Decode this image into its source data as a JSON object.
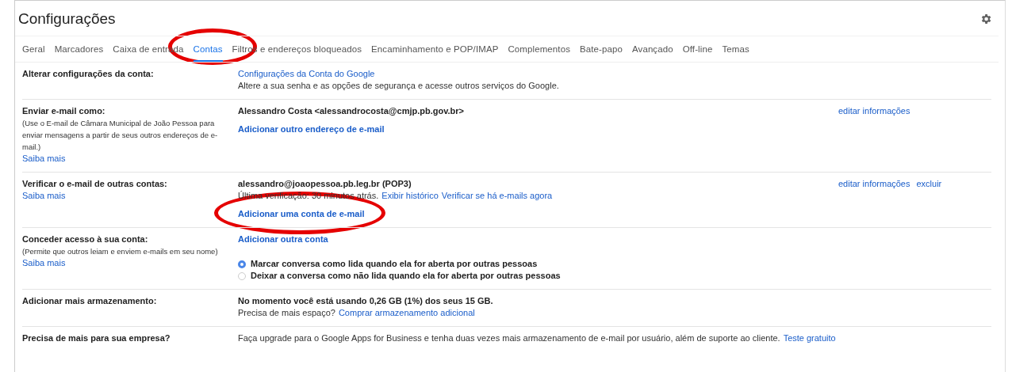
{
  "page": {
    "title": "Configurações"
  },
  "tabs": [
    {
      "label": "Geral",
      "selected": false
    },
    {
      "label": "Marcadores",
      "selected": false
    },
    {
      "label": "Caixa de entrada",
      "selected": false
    },
    {
      "label": "Contas",
      "selected": true
    },
    {
      "label": "Filtros e endereços bloqueados",
      "selected": false
    },
    {
      "label": "Encaminhamento e POP/IMAP",
      "selected": false
    },
    {
      "label": "Complementos",
      "selected": false
    },
    {
      "label": "Bate-papo",
      "selected": false
    },
    {
      "label": "Avançado",
      "selected": false
    },
    {
      "label": "Off-line",
      "selected": false
    },
    {
      "label": "Temas",
      "selected": false
    }
  ],
  "sections": [
    {
      "label": "Alterar configurações da conta:",
      "lines": [
        {
          "kind": "plain",
          "parts": [
            {
              "kind": "link",
              "text": "Configurações da Conta do Google"
            }
          ]
        },
        {
          "kind": "plain",
          "parts": [
            {
              "kind": "text",
              "text": "Altere a sua senha e as opções de segurança e acesse outros serviços do Google."
            }
          ]
        }
      ]
    },
    {
      "label": "Enviar e-mail como:",
      "note": "(Use o E-mail de Câmara Municipal de João Pessoa para enviar mensagens a partir de seus outros endereços de e-mail.)",
      "learn_more": "Saiba mais",
      "lines": [
        {
          "kind": "plain",
          "parts": [
            {
              "kind": "bold",
              "text": "Alessandro Costa <alessandrocosta@cmjp.pb.gov.br>"
            }
          ]
        },
        {
          "kind": "spaced",
          "parts": [
            {
              "kind": "action",
              "text": "Adicionar outro endereço de e-mail"
            }
          ]
        }
      ],
      "actions": [
        "editar informações"
      ]
    },
    {
      "label": "Verificar o e-mail de outras contas:",
      "learn_more": "Saiba mais",
      "lines": [
        {
          "kind": "plain",
          "parts": [
            {
              "kind": "bold",
              "text": "alessandro@joaopessoa.pb.leg.br (POP3)"
            }
          ]
        },
        {
          "kind": "plain",
          "parts": [
            {
              "kind": "text",
              "text": "Última verificação: 30 minutos atrás."
            },
            {
              "kind": "link",
              "text": "Exibir histórico"
            },
            {
              "kind": "link",
              "text": "Verificar se há e-mails agora"
            }
          ]
        },
        {
          "kind": "spaced",
          "parts": [
            {
              "kind": "action",
              "text": "Adicionar uma conta de e-mail"
            }
          ]
        }
      ],
      "actions": [
        "editar informações",
        "excluir"
      ]
    },
    {
      "label": "Conceder acesso à sua conta:",
      "note": "(Permite que outros leiam e enviem e-mails em seu nome)",
      "learn_more": "Saiba mais",
      "lines": [
        {
          "kind": "plain",
          "parts": [
            {
              "kind": "action",
              "text": "Adicionar outra conta"
            }
          ]
        },
        {
          "kind": "radio",
          "selected": true,
          "text": "Marcar conversa como lida quando ela for aberta por outras pessoas"
        },
        {
          "kind": "radio",
          "selected": false,
          "text": "Deixar a conversa como não lida quando ela for aberta por outras pessoas"
        }
      ]
    },
    {
      "label": "Adicionar mais armazenamento:",
      "lines": [
        {
          "kind": "plain",
          "parts": [
            {
              "kind": "bold",
              "text": "No momento você está usando 0,26 GB (1%) dos seus 15 GB."
            }
          ]
        },
        {
          "kind": "plain",
          "parts": [
            {
              "kind": "text",
              "text": "Precisa de mais espaço?"
            },
            {
              "kind": "link",
              "text": "Comprar armazenamento adicional"
            }
          ]
        }
      ]
    },
    {
      "label": "Precisa de mais para sua empresa?",
      "lines": [
        {
          "kind": "plain",
          "parts": [
            {
              "kind": "text",
              "text": "Faça upgrade para o Google Apps for Business e tenha duas vezes mais armazenamento de e-mail por usuário, além de suporte ao cliente."
            },
            {
              "kind": "link",
              "text": "Teste gratuito"
            }
          ]
        }
      ]
    }
  ],
  "annotations": [
    {
      "kind": "ellipse"
    },
    {
      "kind": "ellipse"
    }
  ]
}
